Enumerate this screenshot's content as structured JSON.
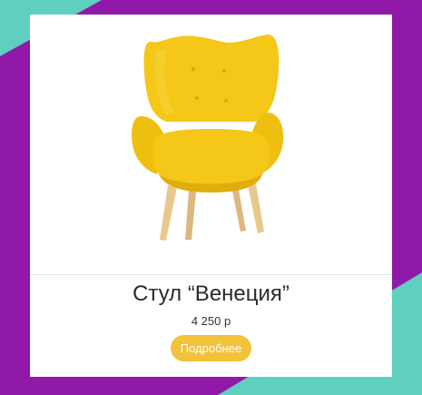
{
  "colors": {
    "background_purple": "#9019a9",
    "background_teal": "#5fcfbf",
    "card": "#ffffff",
    "chair_yellow": "#f4c718",
    "button": "#f2c23a"
  },
  "product": {
    "image_icon": "yellow-armchair-image",
    "title": "Стул “Венеция”",
    "price": "4 250 р",
    "more_label": "Подробнее"
  }
}
